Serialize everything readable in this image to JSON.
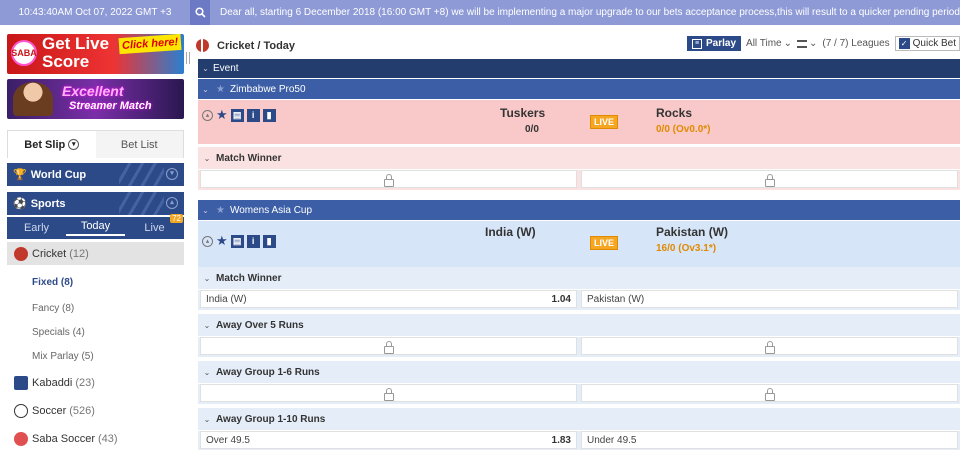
{
  "topbar": {
    "time": "10:43:40AM Oct 07, 2022 GMT +3",
    "announcement": "Dear all, starting 6 December 2018 (16:00 GMT +8) we will be implementing a major upgrade to our bets acceptance process,this will result to a quicker pending period"
  },
  "banners": {
    "live_score": {
      "line1": "Get Live",
      "line2": "Score",
      "click": "Click here!",
      "logo": "SABA"
    },
    "streamer": {
      "line1": "Excellent",
      "line2": "Streamer Match"
    }
  },
  "betslip": {
    "tab1": "Bet Slip",
    "tab2": "Bet List"
  },
  "nav": {
    "world_cup": "World Cup",
    "sports": "Sports",
    "tabs": {
      "early": "Early",
      "today": "Today",
      "live": "Live",
      "live_count": "72"
    }
  },
  "sports": [
    {
      "name": "Cricket",
      "count": "(12)"
    },
    {
      "name": "Kabaddi",
      "count": "(23)"
    },
    {
      "name": "Soccer",
      "count": "(526)"
    },
    {
      "name": "Saba Soccer",
      "count": "(43)"
    }
  ],
  "cricket_sub": [
    {
      "label": "Fixed (8)"
    },
    {
      "label": "Fancy (8)"
    },
    {
      "label": "Specials (4)"
    },
    {
      "label": "Mix Parlay (5)"
    }
  ],
  "main": {
    "title": "Cricket / Today",
    "parlay": "Parlay",
    "time_filter": "All Time",
    "leagues": "(7 / 7) Leagues",
    "quick_bet": "Quick Bet",
    "event_header": "Event"
  },
  "leagues": [
    {
      "name": "Zimbabwe Pro50",
      "home": "Tuskers",
      "home_score": "0/0",
      "away": "Rocks",
      "away_score": "0/0 (Ov0.0*)",
      "live": "LIVE",
      "markets": [
        {
          "title": "Match Winner"
        }
      ]
    },
    {
      "name": "Womens Asia Cup",
      "home": "India (W)",
      "home_score": "",
      "away": "Pakistan (W)",
      "away_score": "16/0 (Ov3.1*)",
      "live": "LIVE",
      "markets": [
        {
          "title": "Match Winner",
          "left_label": "India (W)",
          "left_odd": "1.04",
          "right_label": "Pakistan (W)"
        },
        {
          "title": "Away Over 5 Runs"
        },
        {
          "title": "Away Group 1-6 Runs"
        },
        {
          "title": "Away Group 1-10 Runs",
          "left_label": "Over 49.5",
          "left_odd": "1.83",
          "right_label": "Under 49.5"
        }
      ]
    }
  ],
  "colors": {
    "nav_blue": "#2d4a88",
    "live_orange": "#f5a623",
    "pink_row": "#f9c9c9",
    "blue_row": "#d7e5f8"
  }
}
